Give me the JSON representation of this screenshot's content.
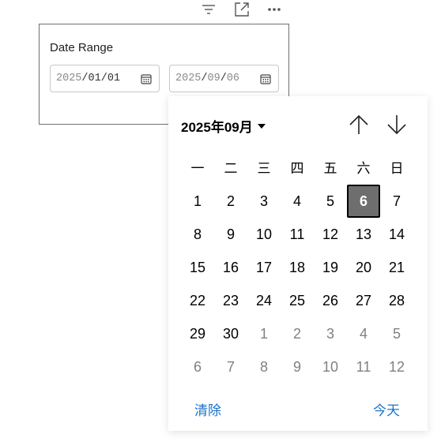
{
  "toolbar": {
    "icons": [
      "filter-icon",
      "expand-icon",
      "more-icon"
    ]
  },
  "card": {
    "title": "Date Range",
    "start_date": {
      "year": "2025",
      "month": "01",
      "day": "01"
    },
    "end_date": {
      "year": "2025",
      "month": "09",
      "day": "06"
    }
  },
  "calendar": {
    "month_label": "2025年09月",
    "weekdays": [
      "一",
      "二",
      "三",
      "四",
      "五",
      "六",
      "日"
    ],
    "selected_day": "6",
    "days": [
      {
        "label": "1",
        "current": true
      },
      {
        "label": "2",
        "current": true
      },
      {
        "label": "3",
        "current": true
      },
      {
        "label": "4",
        "current": true
      },
      {
        "label": "5",
        "current": true
      },
      {
        "label": "6",
        "current": true
      },
      {
        "label": "7",
        "current": true
      },
      {
        "label": "8",
        "current": true
      },
      {
        "label": "9",
        "current": true
      },
      {
        "label": "10",
        "current": true
      },
      {
        "label": "11",
        "current": true
      },
      {
        "label": "12",
        "current": true
      },
      {
        "label": "13",
        "current": true
      },
      {
        "label": "14",
        "current": true
      },
      {
        "label": "15",
        "current": true
      },
      {
        "label": "16",
        "current": true
      },
      {
        "label": "17",
        "current": true
      },
      {
        "label": "18",
        "current": true
      },
      {
        "label": "19",
        "current": true
      },
      {
        "label": "20",
        "current": true
      },
      {
        "label": "21",
        "current": true
      },
      {
        "label": "22",
        "current": true
      },
      {
        "label": "23",
        "current": true
      },
      {
        "label": "24",
        "current": true
      },
      {
        "label": "25",
        "current": true
      },
      {
        "label": "26",
        "current": true
      },
      {
        "label": "27",
        "current": true
      },
      {
        "label": "28",
        "current": true
      },
      {
        "label": "29",
        "current": true
      },
      {
        "label": "30",
        "current": true
      },
      {
        "label": "1",
        "current": false
      },
      {
        "label": "2",
        "current": false
      },
      {
        "label": "3",
        "current": false
      },
      {
        "label": "4",
        "current": false
      },
      {
        "label": "5",
        "current": false
      },
      {
        "label": "6",
        "current": false
      },
      {
        "label": "7",
        "current": false
      },
      {
        "label": "8",
        "current": false
      },
      {
        "label": "9",
        "current": false
      },
      {
        "label": "10",
        "current": false
      },
      {
        "label": "11",
        "current": false
      },
      {
        "label": "12",
        "current": false
      }
    ],
    "clear_label": "清除",
    "today_label": "今天"
  },
  "colors": {
    "accent": "#1a73c8",
    "selected_bg": "#6e6e6e",
    "other_month": "#808080"
  }
}
